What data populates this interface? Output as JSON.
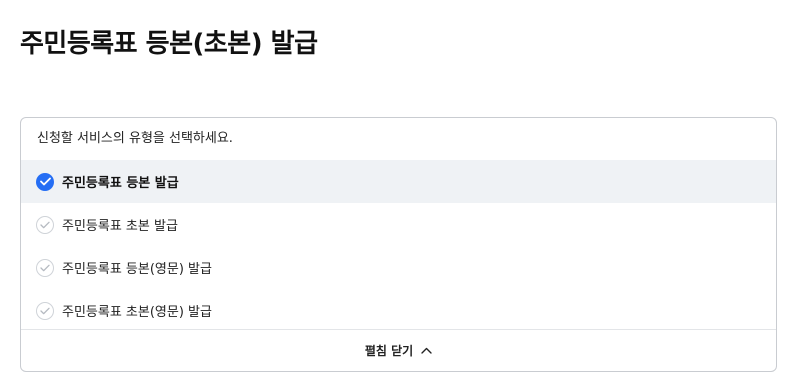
{
  "page": {
    "title": "주민등록표 등본(초본) 발급"
  },
  "selector": {
    "prompt": "신청할 서비스의 유형을 선택하세요.",
    "options": [
      {
        "label": "주민등록표 등본 발급",
        "selected": true
      },
      {
        "label": "주민등록표 초본 발급",
        "selected": false
      },
      {
        "label": "주민등록표 등본(영문) 발급",
        "selected": false
      },
      {
        "label": "주민등록표 초본(영문) 발급",
        "selected": false
      }
    ],
    "toggle_label": "펼침 닫기",
    "toggle_icon": "chevron-up-icon"
  },
  "colors": {
    "accent": "#256ef4",
    "selected_row_bg": "#eff2f5",
    "border": "#c9ccd1"
  }
}
